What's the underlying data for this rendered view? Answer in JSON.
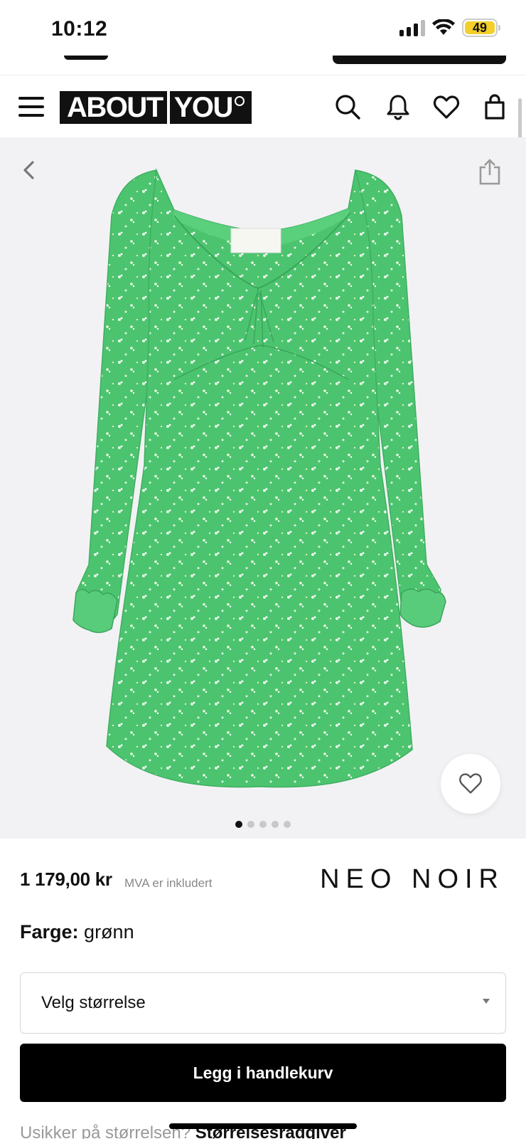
{
  "status_bar": {
    "time": "10:12",
    "battery": "49",
    "icons": [
      "signal-icon",
      "wifi-icon",
      "battery-icon"
    ]
  },
  "header": {
    "logo_left": "ABOUT",
    "logo_right": "YOU",
    "icons": [
      "menu-icon",
      "search-icon",
      "bell-icon",
      "heart-icon",
      "bag-icon"
    ]
  },
  "gallery": {
    "image_count": 5,
    "active_index": 0,
    "icons": [
      "back-icon",
      "share-icon",
      "favorite-icon"
    ]
  },
  "product": {
    "price": "1 179,00 kr",
    "vat_note": "MVA er inkludert",
    "brand": "NEO NOIR",
    "color_label": "Farge:",
    "color_value": "grønn",
    "size_placeholder": "Velg størrelse",
    "add_to_cart": "Legg i handlekurv",
    "size_help_question": "Usikker på størrelsen?",
    "size_help_link": "Størrelsesrådgiver"
  },
  "colors": {
    "dress_green": "#4cc46f",
    "battery_yellow": "#f4cf2a",
    "button_black": "#000000",
    "gallery_bg": "#f2f2f4"
  }
}
